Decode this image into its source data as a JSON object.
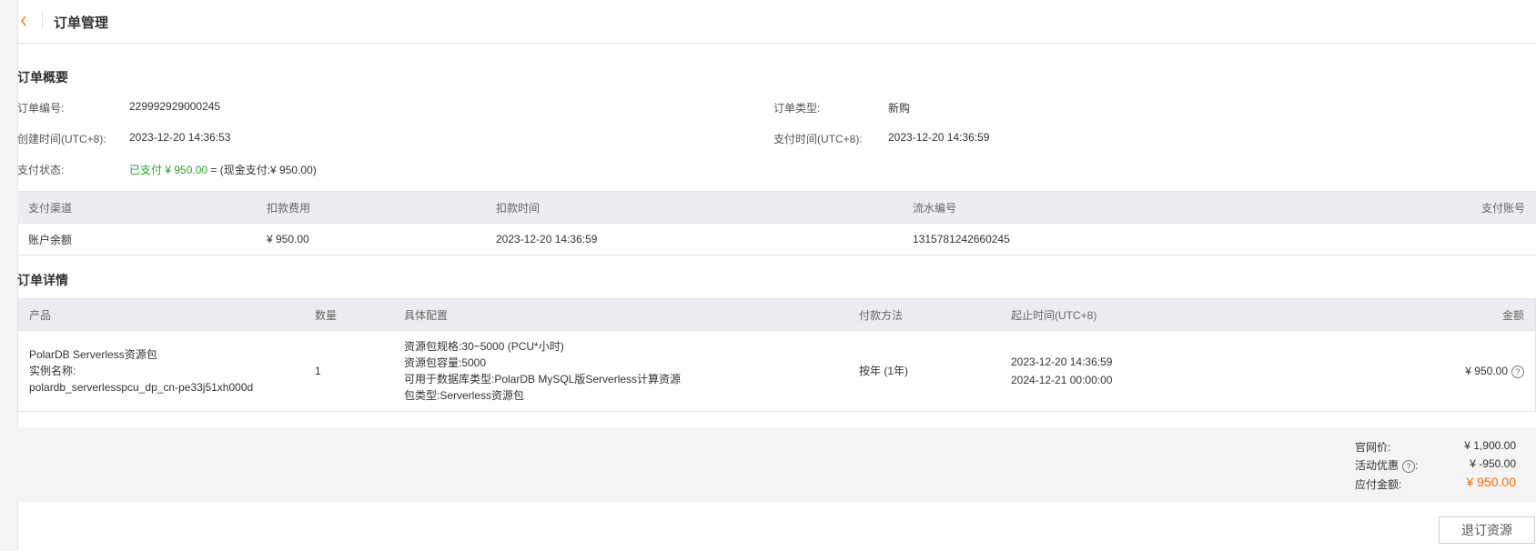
{
  "colors": {
    "accent": "#ff6a00",
    "paid_green": "#2aa52a",
    "header_bg": "#ebedf0",
    "summary_bg": "#f3f4f6"
  },
  "icons": {
    "back": "chevron-left-icon",
    "help": "question-circle-icon"
  },
  "header": {
    "title": "订单管理"
  },
  "overview": {
    "title": "订单概要",
    "order_no_label": "订单编号:",
    "order_no": "229992929000245",
    "order_type_label": "订单类型:",
    "order_type": "新购",
    "created_label": "创建时间(UTC+8):",
    "created": "2023-12-20 14:36:53",
    "paid_time_label": "支付时间(UTC+8):",
    "paid_time": "2023-12-20 14:36:59",
    "status_label": "支付状态:",
    "status_paid": "已支付 ¥ 950.00",
    "status_detail": " = (现金支付:¥ 950.00)"
  },
  "payment_table": {
    "headers": [
      "支付渠道",
      "扣款费用",
      "扣款时间",
      "流水编号",
      "支付账号"
    ],
    "rows": [
      {
        "channel": "账户余额",
        "amount": "¥ 950.00",
        "time": "2023-12-20 14:36:59",
        "serial": "1315781242660245",
        "account": ""
      }
    ]
  },
  "details": {
    "title": "订单详情",
    "headers": [
      "产品",
      "数量",
      "具体配置",
      "付款方法",
      "起止时间(UTC+8)",
      "金额"
    ],
    "row": {
      "product_name": "PolarDB Serverless资源包",
      "instance_label": "实例名称:",
      "instance_name": "polardb_serverlesspcu_dp_cn-pe33j51xh000d",
      "quantity": "1",
      "config": [
        "资源包规格:30~5000 (PCU*小时)",
        "资源包容量:5000",
        "可用于数据库类型:PolarDB MySQL版Serverless计算资源",
        "包类型:Serverless资源包"
      ],
      "payment_method": "按年 (1年)",
      "start_time": "2023-12-20 14:36:59",
      "end_time": "2024-12-21 00:00:00",
      "amount": "¥ 950.00"
    }
  },
  "summary": {
    "list_price_label": "官网价:",
    "list_price": "¥ 1,900.00",
    "discount_label": "活动优惠",
    "discount_colon": ":",
    "discount": "¥ -950.00",
    "payable_label": "应付金额:",
    "payable": "¥ 950.00"
  },
  "actions": {
    "refund": "退订资源"
  }
}
